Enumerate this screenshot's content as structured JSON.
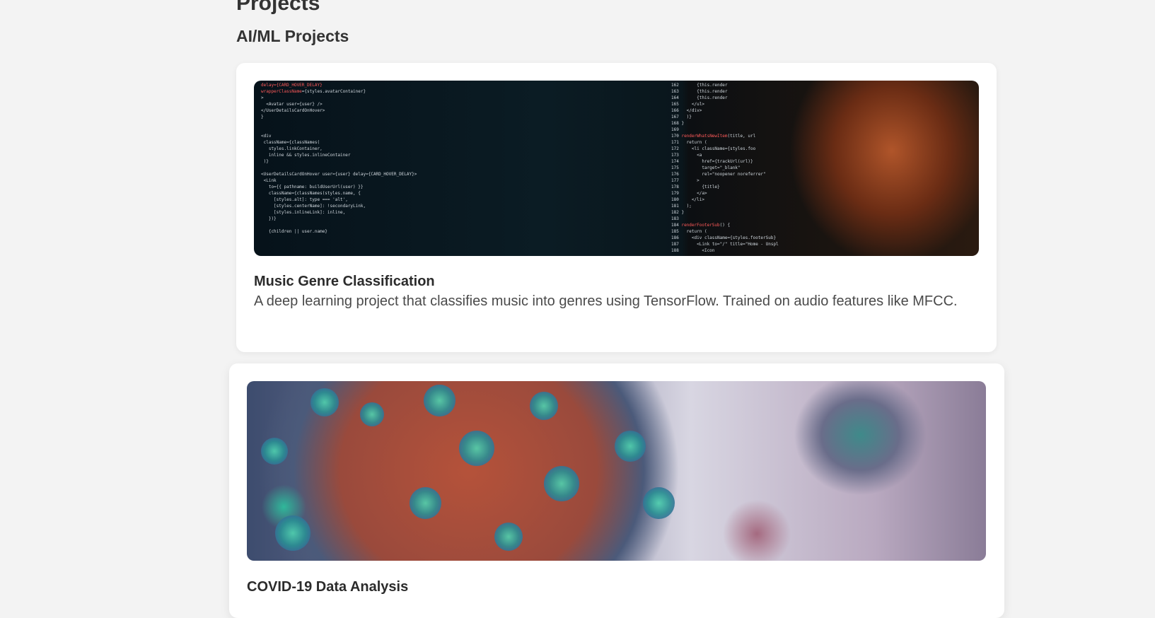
{
  "page": {
    "title": "Projects",
    "section_title": "AI/ML Projects"
  },
  "projects": [
    {
      "title": "Music Genre Classification",
      "description": "A deep learning project that classifies music into genres using TensorFlow. Trained on audio features like MFCC.",
      "image": "code-on-screen-photo"
    },
    {
      "title": "COVID-19 Data Analysis",
      "image": "coronavirus-render-photo"
    }
  ],
  "colors": {
    "background": "#f3f3f3",
    "card": "#ffffff",
    "text": "#2b2b2b"
  }
}
